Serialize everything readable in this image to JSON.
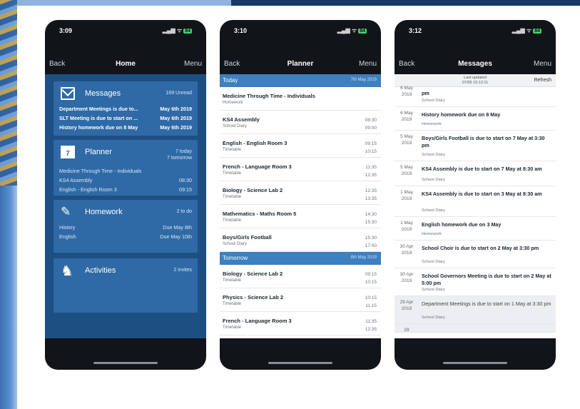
{
  "phones": [
    {
      "time": "3:09",
      "signal": "▂▄▆ ᯤ",
      "battery": "84",
      "nav": {
        "back": "Back",
        "title": "Home",
        "menu": "Menu"
      },
      "cards": [
        {
          "icon": "envelope-icon",
          "title": "Messages",
          "badge": "169 Unread",
          "rows": [
            {
              "left": "Department Meetings is due to...",
              "right": "May 6th 2019"
            },
            {
              "left": "SLT Meeting is due to start on ...",
              "right": "May 6th 2019"
            },
            {
              "left": "History homework due on 8 May",
              "right": "May 6th 2019"
            }
          ]
        },
        {
          "icon": "calendar-icon",
          "icon_text": "7",
          "title": "Planner",
          "badge": "7 today",
          "badge2": "7 tomorrow",
          "rows": [
            {
              "left": "Medicine Through Time - Individuals",
              "right": ""
            },
            {
              "left": "KS4 Assembly",
              "right": "08:30"
            },
            {
              "left": "English - English Room 3",
              "right": "09:15"
            }
          ]
        },
        {
          "icon": "pencil-icon",
          "title": "Homework",
          "badge": "2 to do",
          "rows": [
            {
              "left": "History",
              "right": "Due May 8th"
            },
            {
              "left": "English",
              "right": "Due May 10th"
            }
          ]
        },
        {
          "icon": "chess-knight-icon",
          "title": "Activities",
          "badge": "2 invites",
          "rows": []
        }
      ]
    },
    {
      "time": "3:10",
      "signal": "▂▄▆ ᯤ",
      "battery": "84",
      "nav": {
        "back": "Back",
        "title": "Planner",
        "menu": "Menu"
      },
      "sections": [
        {
          "label": "Today",
          "date": "7th May 2019",
          "items": [
            {
              "title": "Medicine Through Time - Individuals",
              "sub": "Homework",
              "start": "",
              "end": ""
            },
            {
              "title": "KS4 Assembly",
              "sub": "School Diary",
              "start": "08:30",
              "end": "09:00"
            },
            {
              "title": "English - English Room 3",
              "sub": "Timetable",
              "start": "09:15",
              "end": "10:15"
            },
            {
              "title": "French - Language Room 3",
              "sub": "Timetable",
              "start": "11:35",
              "end": "12:35"
            },
            {
              "title": "Biology - Science Lab 2",
              "sub": "Timetable",
              "start": "12:35",
              "end": "13:35"
            },
            {
              "title": "Mathematics - Maths Room 5",
              "sub": "Timetable",
              "start": "14:30",
              "end": "15:30"
            },
            {
              "title": "Boys/Girls Football",
              "sub": "School Diary",
              "start": "15:30",
              "end": "17:00"
            }
          ]
        },
        {
          "label": "Tomorrow",
          "date": "8th May 2019",
          "items": [
            {
              "title": "Biology - Science Lab 2",
              "sub": "Timetable",
              "start": "09:15",
              "end": "10:15"
            },
            {
              "title": "Physics - Science Lab 2",
              "sub": "Timetable",
              "start": "10:15",
              "end": "11:15"
            },
            {
              "title": "French - Language Room 3",
              "sub": "Timetable",
              "start": "11:35",
              "end": "12:35"
            }
          ]
        }
      ]
    },
    {
      "time": "3:12",
      "signal": "▂▄▆ ᯤ",
      "battery": "84",
      "nav": {
        "back": "Back",
        "title": "Messages",
        "menu": "Menu"
      },
      "last_updated_label": "Last updated",
      "last_updated_value": "07/05 15:12:11",
      "refresh": "Refresh",
      "messages": [
        {
          "date": "6 May 2019",
          "title": "pm",
          "sub": "School Diary",
          "read": false
        },
        {
          "date": "6 May 2019",
          "title": "History homework due on 8 May",
          "sub": "Homework",
          "read": false
        },
        {
          "date": "5 May 2019",
          "title": "Boys/Girls Football is due to start on 7 May at 3:30 pm",
          "sub": "School Diary",
          "read": false
        },
        {
          "date": "5 May 2019",
          "title": "KS4 Assembly is due to start on 7 May at 8:30 am",
          "sub": "School Diary",
          "read": false
        },
        {
          "date": "1 May 2019",
          "title": "KS4 Assembly is due to start on 3 May at 8:30 am",
          "sub": "School Diary",
          "read": false
        },
        {
          "date": "1 May 2019",
          "title": "English homework due on 3 May",
          "sub": "Homework",
          "read": false
        },
        {
          "date": "30 Apr 2019",
          "title": "School Choir is due to start on 2 May at 3:30 pm",
          "sub": "School Diary",
          "read": false
        },
        {
          "date": "30 Apr 2019",
          "title": "School Governors Meeting is due to start on 2 May at 5:00 pm",
          "sub": "School Diary",
          "read": false
        },
        {
          "date": "29 Apr 2019",
          "title": "Department Meetings is due to start on 1 May at 3:30 pm",
          "sub": "School Diary",
          "read": true
        },
        {
          "date": "29",
          "title": "",
          "sub": "",
          "read": true
        }
      ]
    }
  ]
}
